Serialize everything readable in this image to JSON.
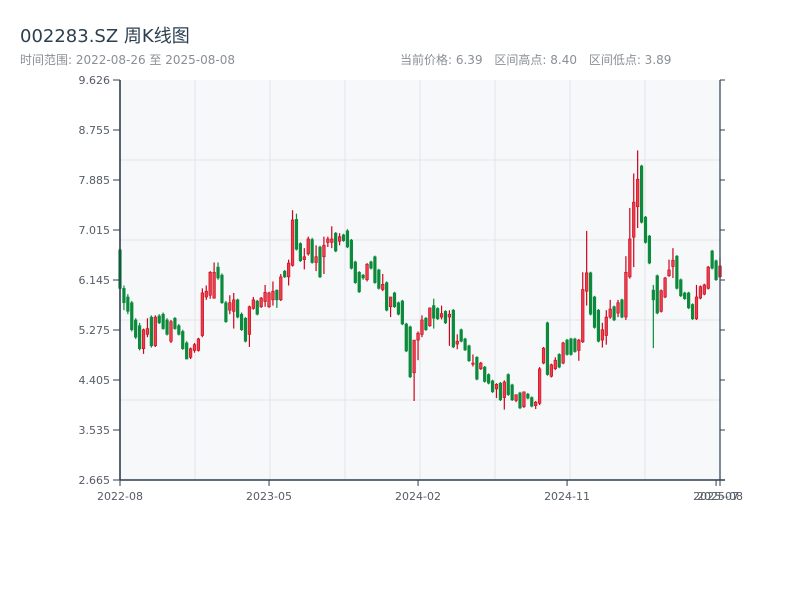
{
  "header": {
    "title": "002283.SZ 周K线图",
    "range_label": "时间范围: 2022-08-26 至 2025-08-08",
    "current_price": "当前价格: 6.39",
    "range_high": "区间高点: 8.40",
    "range_low": "区间低点: 3.89"
  },
  "chart_data": {
    "type": "candlestick",
    "title": "002283.SZ 周K线图",
    "period": "weekly",
    "start_date": "2022-08-26",
    "end_date": "2025-08-08",
    "current_price": 6.39,
    "range_high": 8.4,
    "range_low": 3.89,
    "ylim": [
      2.665,
      9.626
    ],
    "y_ticks": [
      "9.626",
      "8.755",
      "7.885",
      "7.015",
      "6.145",
      "5.275",
      "4.405",
      "3.535",
      "2.665"
    ],
    "x_ticks": [
      {
        "label": "2022-08",
        "index": 0
      },
      {
        "label": "2023-05",
        "index": 38
      },
      {
        "label": "2024-02",
        "index": 76
      },
      {
        "label": "2024-11",
        "index": 114
      },
      {
        "label": "2025-07",
        "index": 152
      },
      {
        "label": "2025-08",
        "index": 153
      }
    ],
    "grid": true,
    "colors": {
      "up": "#d0021b",
      "up_fill": "#e8404a",
      "down": "#0a8a3a",
      "axis": "#2c3e50",
      "grid": "#e1e5ea",
      "plot_bg": "#f6f8fa"
    },
    "ohlc_fields": [
      "open",
      "high",
      "low",
      "close"
    ],
    "candles": [
      [
        6.67,
        6.7,
        5.97,
        6.0
      ],
      [
        6.0,
        6.05,
        5.62,
        5.75
      ],
      [
        5.85,
        5.9,
        5.55,
        5.6
      ],
      [
        5.75,
        5.78,
        5.25,
        5.28
      ],
      [
        5.45,
        5.48,
        5.12,
        5.15
      ],
      [
        5.35,
        5.4,
        4.92,
        4.95
      ],
      [
        4.95,
        5.3,
        4.86,
        5.28
      ],
      [
        5.2,
        5.48,
        5.15,
        5.3
      ],
      [
        5.5,
        5.53,
        4.97,
        5.0
      ],
      [
        5.0,
        5.53,
        4.98,
        5.5
      ],
      [
        5.52,
        5.55,
        5.38,
        5.4
      ],
      [
        5.55,
        5.58,
        5.28,
        5.3
      ],
      [
        5.45,
        5.48,
        5.18,
        5.2
      ],
      [
        5.08,
        5.45,
        5.05,
        5.42
      ],
      [
        5.48,
        5.5,
        5.28,
        5.3
      ],
      [
        5.35,
        5.38,
        5.18,
        5.2
      ],
      [
        5.25,
        5.28,
        4.93,
        4.95
      ],
      [
        5.05,
        5.08,
        4.77,
        4.77
      ],
      [
        4.8,
        4.97,
        4.77,
        4.95
      ],
      [
        4.92,
        5.05,
        4.88,
        5.02
      ],
      [
        4.92,
        5.14,
        4.9,
        5.12
      ],
      [
        5.18,
        6.0,
        5.15,
        5.92
      ],
      [
        5.85,
        6.05,
        5.8,
        5.95
      ],
      [
        5.88,
        6.3,
        5.82,
        6.28
      ],
      [
        5.83,
        6.45,
        5.82,
        6.28
      ],
      [
        6.37,
        6.45,
        6.15,
        6.18
      ],
      [
        6.23,
        6.26,
        5.73,
        5.75
      ],
      [
        5.75,
        5.78,
        5.4,
        5.42
      ],
      [
        5.62,
        5.88,
        5.55,
        5.75
      ],
      [
        5.6,
        5.92,
        5.3,
        5.8
      ],
      [
        5.8,
        5.82,
        5.48,
        5.5
      ],
      [
        5.55,
        5.58,
        5.26,
        5.28
      ],
      [
        5.48,
        5.5,
        5.06,
        5.08
      ],
      [
        5.2,
        5.7,
        4.98,
        5.68
      ],
      [
        5.65,
        5.85,
        5.63,
        5.8
      ],
      [
        5.78,
        5.8,
        5.53,
        5.55
      ],
      [
        5.68,
        5.85,
        5.66,
        5.83
      ],
      [
        5.77,
        6.06,
        5.68,
        5.93
      ],
      [
        5.68,
        5.94,
        5.66,
        5.92
      ],
      [
        5.8,
        6.12,
        5.7,
        5.95
      ],
      [
        5.97,
        5.98,
        5.66,
        5.8
      ],
      [
        5.8,
        6.25,
        5.78,
        6.2
      ],
      [
        6.3,
        6.32,
        6.18,
        6.2
      ],
      [
        6.2,
        6.5,
        6.05,
        6.44
      ],
      [
        6.4,
        7.36,
        6.38,
        7.19
      ],
      [
        7.2,
        7.3,
        6.66,
        6.68
      ],
      [
        6.78,
        6.8,
        6.46,
        6.48
      ],
      [
        6.5,
        6.7,
        6.33,
        6.55
      ],
      [
        6.6,
        6.9,
        6.57,
        6.86
      ],
      [
        6.85,
        6.88,
        6.43,
        6.45
      ],
      [
        6.45,
        6.75,
        6.3,
        6.55
      ],
      [
        6.72,
        6.74,
        6.18,
        6.2
      ],
      [
        6.55,
        6.9,
        6.25,
        6.75
      ],
      [
        6.8,
        6.9,
        6.72,
        6.86
      ],
      [
        6.8,
        7.08,
        6.7,
        6.86
      ],
      [
        6.96,
        6.98,
        6.63,
        6.65
      ],
      [
        6.82,
        6.96,
        6.75,
        6.9
      ],
      [
        6.93,
        6.95,
        6.81,
        6.83
      ],
      [
        7.0,
        7.03,
        6.7,
        6.72
      ],
      [
        6.84,
        6.86,
        6.33,
        6.35
      ],
      [
        6.46,
        6.48,
        6.08,
        6.1
      ],
      [
        6.28,
        6.3,
        5.92,
        5.94
      ],
      [
        6.23,
        6.25,
        6.15,
        6.18
      ],
      [
        6.15,
        6.44,
        6.12,
        6.42
      ],
      [
        6.46,
        6.48,
        6.33,
        6.35
      ],
      [
        6.55,
        6.57,
        6.08,
        6.1
      ],
      [
        6.32,
        6.34,
        5.98,
        6.0
      ],
      [
        5.98,
        6.25,
        5.95,
        6.07
      ],
      [
        6.1,
        6.12,
        5.6,
        5.62
      ],
      [
        5.68,
        5.85,
        5.5,
        5.85
      ],
      [
        5.92,
        5.94,
        5.66,
        5.68
      ],
      [
        5.75,
        5.77,
        5.53,
        5.55
      ],
      [
        5.78,
        5.8,
        5.36,
        5.38
      ],
      [
        5.38,
        5.4,
        4.89,
        4.91
      ],
      [
        5.33,
        5.35,
        4.44,
        4.46
      ],
      [
        4.53,
        5.1,
        4.04,
        5.1
      ],
      [
        5.1,
        5.25,
        4.75,
        5.22
      ],
      [
        5.2,
        5.53,
        5.15,
        5.45
      ],
      [
        5.48,
        5.5,
        5.26,
        5.28
      ],
      [
        5.35,
        5.66,
        5.33,
        5.66
      ],
      [
        5.7,
        5.82,
        5.3,
        5.48
      ],
      [
        5.65,
        5.67,
        5.45,
        5.47
      ],
      [
        5.5,
        5.7,
        5.46,
        5.56
      ],
      [
        5.6,
        5.62,
        5.38,
        5.4
      ],
      [
        5.5,
        5.62,
        5.0,
        5.55
      ],
      [
        5.62,
        5.64,
        4.96,
        4.98
      ],
      [
        5.03,
        5.2,
        4.94,
        5.08
      ],
      [
        5.28,
        5.3,
        5.06,
        5.08
      ],
      [
        5.12,
        5.14,
        4.91,
        4.93
      ],
      [
        5.0,
        5.02,
        4.72,
        4.74
      ],
      [
        4.68,
        4.85,
        4.64,
        4.7
      ],
      [
        4.8,
        4.82,
        4.4,
        4.42
      ],
      [
        4.6,
        4.72,
        4.58,
        4.7
      ],
      [
        4.63,
        4.65,
        4.36,
        4.38
      ],
      [
        4.5,
        4.52,
        4.33,
        4.35
      ],
      [
        4.39,
        4.41,
        4.18,
        4.2
      ],
      [
        4.25,
        4.35,
        4.09,
        4.33
      ],
      [
        4.35,
        4.37,
        4.04,
        4.06
      ],
      [
        4.1,
        4.4,
        3.89,
        4.37
      ],
      [
        4.5,
        4.52,
        4.13,
        4.15
      ],
      [
        4.32,
        4.34,
        4.04,
        4.06
      ],
      [
        4.05,
        4.15,
        4.02,
        4.15
      ],
      [
        4.18,
        4.2,
        3.9,
        3.92
      ],
      [
        3.94,
        4.2,
        3.92,
        4.2
      ],
      [
        4.16,
        4.18,
        4.07,
        4.09
      ],
      [
        4.1,
        4.12,
        3.93,
        3.95
      ],
      [
        3.96,
        4.04,
        3.9,
        4.02
      ],
      [
        4.0,
        4.63,
        3.97,
        4.6
      ],
      [
        4.7,
        4.98,
        4.68,
        4.96
      ],
      [
        5.4,
        5.42,
        4.48,
        4.5
      ],
      [
        4.47,
        4.69,
        4.45,
        4.67
      ],
      [
        4.6,
        4.8,
        4.58,
        4.75
      ],
      [
        4.85,
        4.87,
        4.61,
        4.63
      ],
      [
        4.7,
        5.07,
        4.68,
        5.05
      ],
      [
        5.1,
        5.12,
        4.83,
        4.85
      ],
      [
        5.12,
        5.14,
        4.83,
        4.85
      ],
      [
        5.12,
        5.14,
        4.88,
        4.9
      ],
      [
        4.92,
        5.12,
        4.74,
        5.1
      ],
      [
        5.07,
        6.28,
        5.05,
        5.98
      ],
      [
        5.95,
        7.0,
        5.7,
        6.27
      ],
      [
        6.27,
        6.29,
        5.53,
        5.55
      ],
      [
        5.85,
        5.87,
        5.3,
        5.32
      ],
      [
        5.62,
        5.64,
        5.06,
        5.08
      ],
      [
        5.1,
        5.4,
        4.97,
        5.28
      ],
      [
        5.18,
        5.62,
        5.02,
        5.5
      ],
      [
        5.5,
        5.8,
        5.47,
        5.64
      ],
      [
        5.68,
        5.7,
        5.43,
        5.45
      ],
      [
        5.57,
        5.8,
        5.5,
        5.75
      ],
      [
        5.8,
        5.82,
        5.48,
        5.5
      ],
      [
        5.5,
        6.56,
        5.45,
        6.28
      ],
      [
        6.2,
        7.4,
        6.17,
        6.86
      ],
      [
        6.89,
        8.0,
        6.37,
        7.5
      ],
      [
        7.42,
        8.4,
        7.05,
        7.9
      ],
      [
        8.13,
        8.15,
        7.13,
        7.15
      ],
      [
        7.24,
        7.26,
        6.78,
        6.8
      ],
      [
        6.91,
        6.93,
        6.42,
        6.44
      ],
      [
        5.97,
        6.06,
        4.96,
        5.8
      ],
      [
        6.22,
        6.24,
        5.55,
        5.57
      ],
      [
        5.6,
        5.98,
        5.58,
        5.96
      ],
      [
        5.85,
        6.2,
        5.83,
        6.18
      ],
      [
        6.22,
        6.5,
        6.2,
        6.32
      ],
      [
        6.38,
        6.7,
        6.18,
        6.49
      ],
      [
        6.56,
        6.58,
        5.98,
        6.0
      ],
      [
        6.15,
        6.17,
        5.85,
        5.87
      ],
      [
        5.92,
        5.94,
        5.8,
        5.82
      ],
      [
        5.92,
        5.94,
        5.64,
        5.66
      ],
      [
        5.72,
        5.74,
        5.45,
        5.47
      ],
      [
        5.47,
        6.06,
        5.45,
        5.85
      ],
      [
        5.83,
        6.05,
        5.81,
        6.03
      ],
      [
        5.9,
        6.08,
        5.88,
        6.06
      ],
      [
        6.0,
        6.39,
        5.98,
        6.37
      ],
      [
        6.65,
        6.67,
        6.33,
        6.35
      ],
      [
        6.48,
        6.5,
        6.13,
        6.15
      ],
      [
        6.2,
        6.53,
        6.18,
        6.39
      ]
    ]
  }
}
